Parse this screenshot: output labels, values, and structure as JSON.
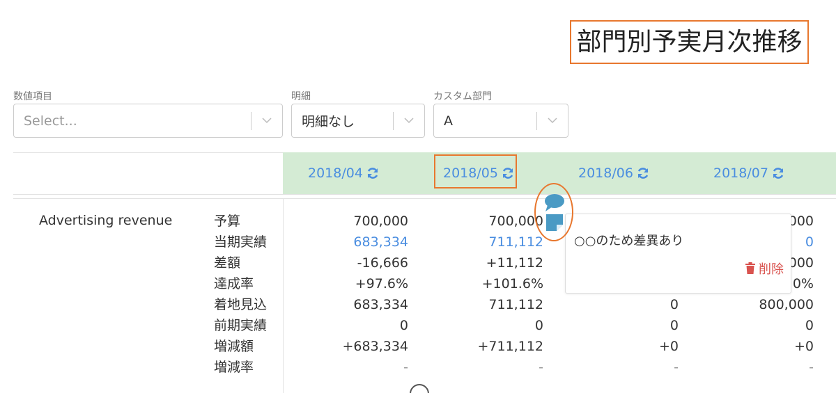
{
  "page": {
    "title": "部門別予実月次推移"
  },
  "filters": [
    {
      "label": "数値項目",
      "value": "Select...",
      "is_placeholder": true
    },
    {
      "label": "明細",
      "value": "明細なし",
      "is_placeholder": false
    },
    {
      "label": "カスタム部門",
      "value": "A",
      "is_placeholder": false
    }
  ],
  "months": [
    "2018/04",
    "2018/05",
    "2018/06",
    "2018/07"
  ],
  "item": {
    "name": "Advertising revenue"
  },
  "row_labels": [
    "予算",
    "当期実績",
    "差額",
    "達成率",
    "着地見込",
    "前期実績",
    "増減額",
    "増減率"
  ],
  "columns": [
    [
      "700,000",
      "683,334",
      "-16,666",
      "+97.6%",
      "683,334",
      "0",
      "+683,334",
      "-"
    ],
    [
      "700,000",
      "711,112",
      "+11,112",
      "+101.6%",
      "711,112",
      "0",
      "+711,112",
      "-"
    ],
    [
      "",
      "",
      "",
      "",
      "0",
      "0",
      "+0",
      "-"
    ],
    [
      "000",
      "0",
      "000",
      "0%",
      "800,000",
      "0",
      "+0",
      "-"
    ]
  ],
  "comment_popover": {
    "text": "○○のため差異あり",
    "delete_label": "削除"
  },
  "colors": {
    "accent_blue": "#4a8de0",
    "header_green": "#d4ebd4",
    "highlight_orange": "#e8772e",
    "delete_red": "#d9534f"
  }
}
